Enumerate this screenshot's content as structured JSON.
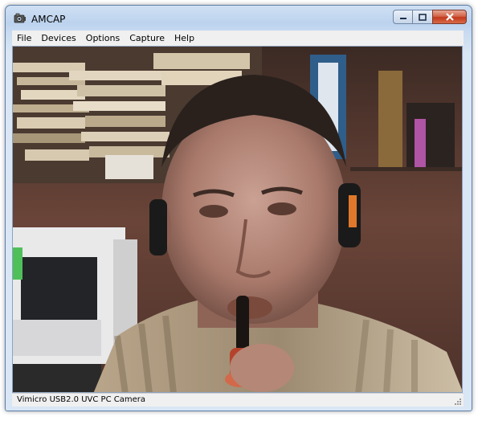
{
  "window": {
    "title": "AMCAP"
  },
  "menu": [
    {
      "label": "File"
    },
    {
      "label": "Devices"
    },
    {
      "label": "Options"
    },
    {
      "label": "Capture"
    },
    {
      "label": "Help"
    }
  ],
  "status": {
    "text": "Vimicro USB2.0 UVC PC Camera"
  },
  "caption_buttons": [
    "minimize-icon",
    "maximize-icon",
    "close-icon"
  ],
  "colors": {
    "close_button": "#c2391b",
    "frame": "#bcd3ee"
  }
}
